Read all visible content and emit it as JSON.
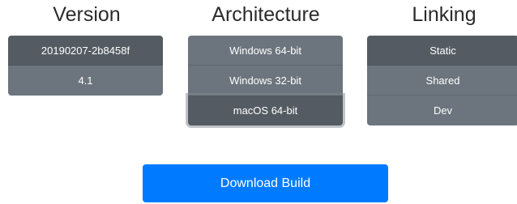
{
  "columns": {
    "version": {
      "title": "Version",
      "options": [
        "20190207-2b8458f",
        "4.1"
      ],
      "selected": "20190207-2b8458f"
    },
    "architecture": {
      "title": "Architecture",
      "options": [
        "Windows 64-bit",
        "Windows 32-bit",
        "macOS 64-bit"
      ],
      "selected": "macOS 64-bit"
    },
    "linking": {
      "title": "Linking",
      "options": [
        "Static",
        "Shared",
        "Dev"
      ],
      "selected": "Static"
    }
  },
  "download": {
    "label": "Download Build"
  },
  "colors": {
    "option_bg": "#6c757d",
    "option_active_bg": "#545b62",
    "primary": "#007bff"
  }
}
